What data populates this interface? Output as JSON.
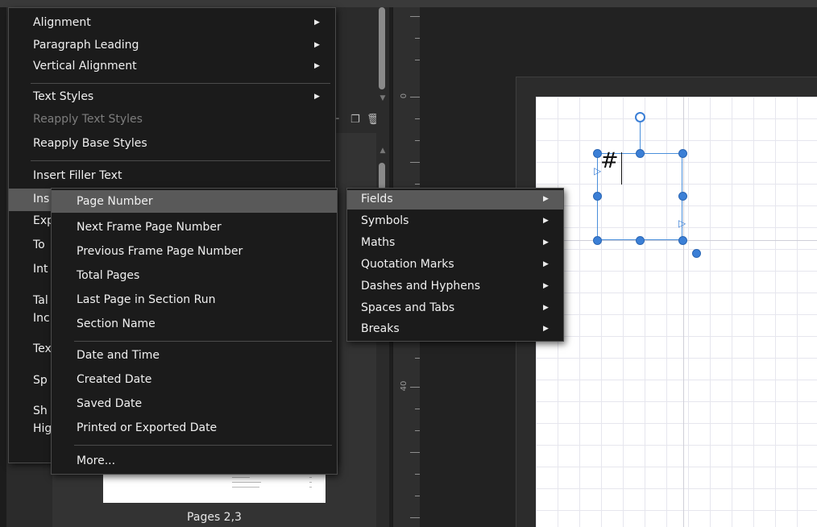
{
  "context_menu": {
    "items": [
      {
        "label": "Alignment",
        "has_submenu": true
      },
      {
        "label": "Paragraph Leading",
        "has_submenu": true
      },
      {
        "label": "Vertical Alignment",
        "has_submenu": true
      },
      {
        "label": "Text Styles",
        "has_submenu": true
      },
      {
        "label": "Reapply Text Styles",
        "disabled": true
      },
      {
        "label": "Reapply Base Styles"
      },
      {
        "label": "Insert Filler Text"
      },
      {
        "label": "Ins",
        "highlighted": true
      },
      {
        "label": "Exp"
      },
      {
        "label": "To"
      },
      {
        "label": "Int"
      },
      {
        "label": "Tal"
      },
      {
        "label": "Inc"
      },
      {
        "label": "Tex"
      },
      {
        "label": "Sp"
      },
      {
        "label": "Sh"
      },
      {
        "label": "Hig"
      }
    ]
  },
  "categories_menu": {
    "items": [
      {
        "label": "Fields",
        "highlighted": true
      },
      {
        "label": "Symbols"
      },
      {
        "label": "Maths"
      },
      {
        "label": "Quotation Marks"
      },
      {
        "label": "Dashes and Hyphens"
      },
      {
        "label": "Spaces and Tabs"
      },
      {
        "label": "Breaks"
      }
    ]
  },
  "fields_menu": {
    "items": [
      {
        "label": "Page Number",
        "highlighted": true
      },
      {
        "label": "Next Frame Page Number"
      },
      {
        "label": "Previous Frame Page Number"
      },
      {
        "label": "Total Pages"
      },
      {
        "label": "Last Page in Section Run"
      },
      {
        "label": "Section Name"
      },
      {
        "label": "Date and Time"
      },
      {
        "label": "Created Date"
      },
      {
        "label": "Saved Date"
      },
      {
        "label": "Printed or Exported Date"
      },
      {
        "label": "More..."
      }
    ]
  },
  "pages_panel": {
    "thumbnail_caption": "Pages 2,3"
  },
  "ruler": {
    "labels": [
      "0",
      "40"
    ]
  },
  "canvas": {
    "frame_text": "#"
  },
  "colors": {
    "menu_bg": "#1b1b1b",
    "menu_highlight": "#595959",
    "selection_blue": "#3b7fd6",
    "page_white": "#ffffff"
  }
}
